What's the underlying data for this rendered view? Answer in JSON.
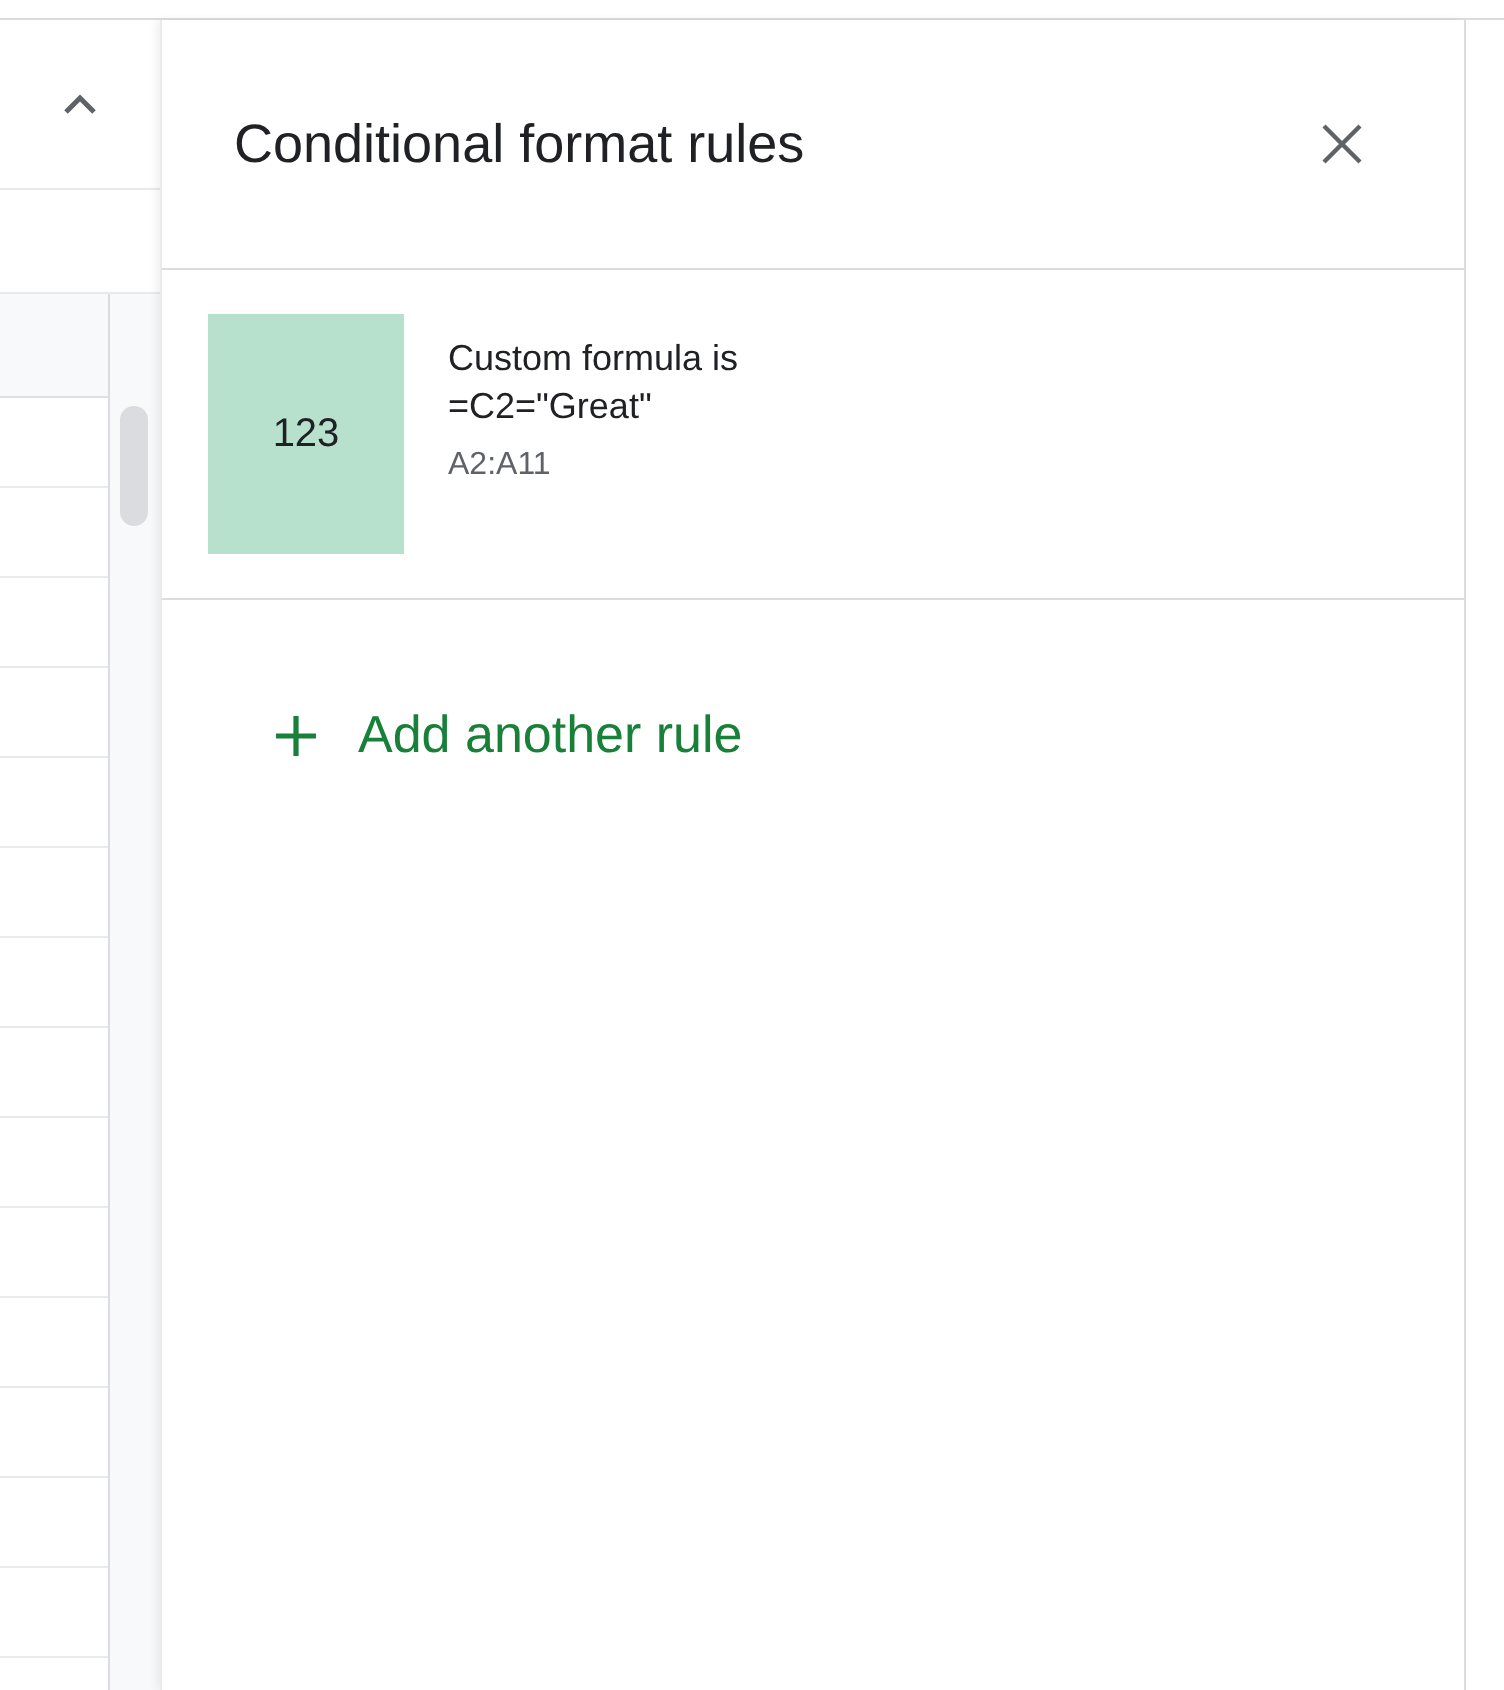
{
  "panel": {
    "title": "Conditional format rules"
  },
  "rules": [
    {
      "preview": "123",
      "condition": "Custom formula is",
      "formula": "=C2=\"Great\"",
      "range": "A2:A11"
    }
  ],
  "add_rule": {
    "label": "Add another rule"
  }
}
